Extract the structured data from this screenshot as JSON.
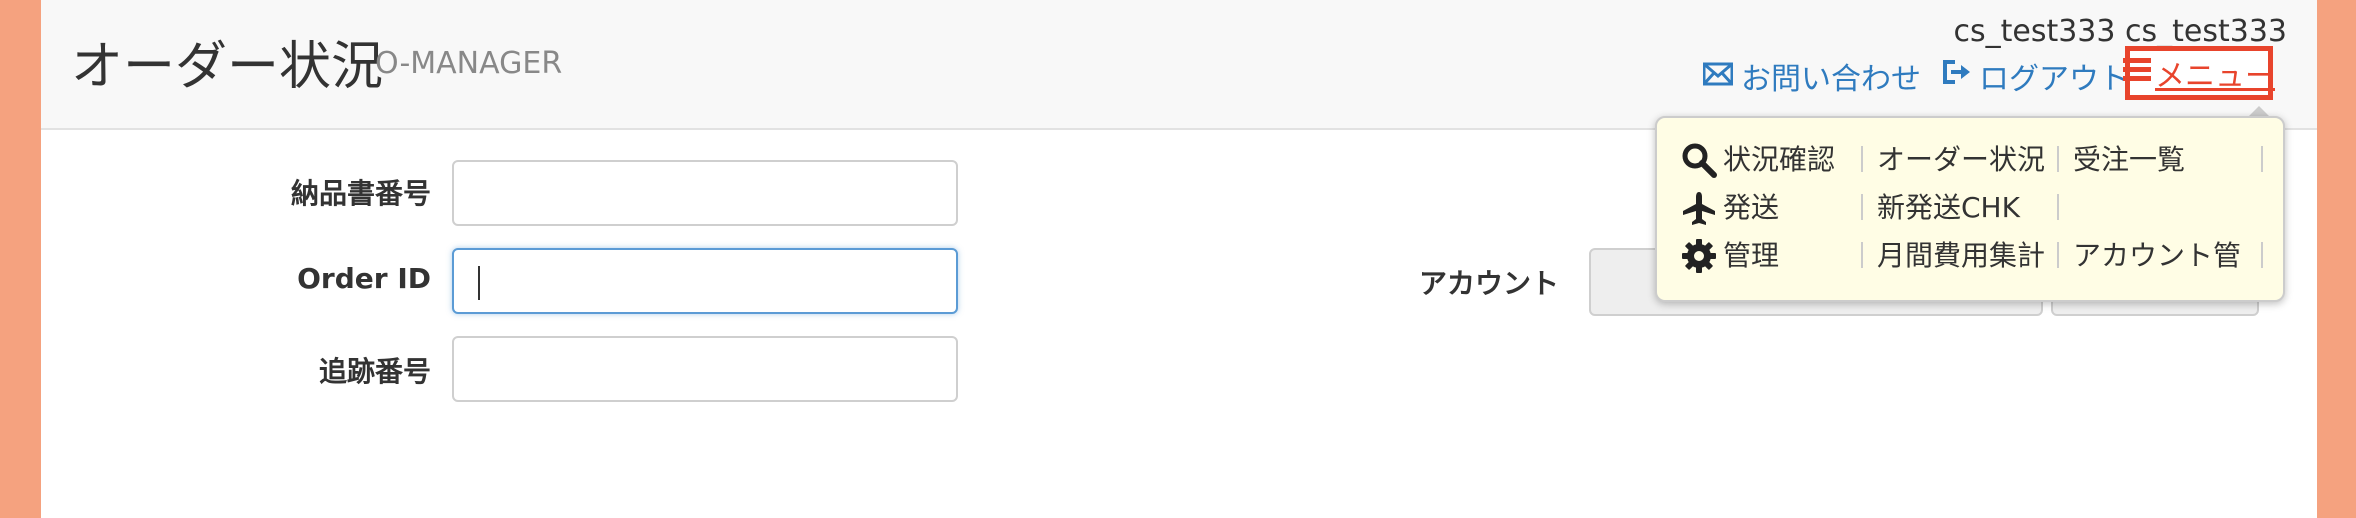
{
  "header": {
    "title": "オーダー状況",
    "subtitle": "O-MANAGER",
    "username": "cs_test333 cs_test333",
    "contact_label": "お問い合わせ",
    "logout_label": "ログアウト",
    "menu_label": "メニュー"
  },
  "form": {
    "delivery_note_label": "納品書番号",
    "delivery_note_value": "",
    "order_id_label": "Order ID",
    "order_id_value": "",
    "tracking_label": "追跡番号",
    "tracking_value": "",
    "account_label": "アカウント",
    "account_value": ""
  },
  "menu": {
    "rows": [
      {
        "category": "状況確認",
        "icon": "search-icon",
        "items": [
          "オーダー状況",
          "受注一覧"
        ]
      },
      {
        "category": "発送",
        "icon": "airplane-icon",
        "items": [
          "新発送CHK"
        ]
      },
      {
        "category": "管理",
        "icon": "gear-icon",
        "items": [
          "月間費用集計",
          "アカウント管"
        ]
      }
    ]
  },
  "colors": {
    "page_border": "#f5a27f",
    "link": "#2f7bbf",
    "menu_highlight": "#e8442c",
    "dropdown_bg": "#fffde5"
  }
}
